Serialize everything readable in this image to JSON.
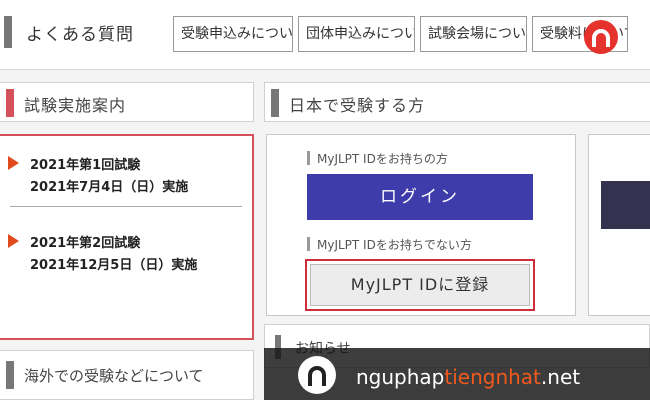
{
  "faq": {
    "title": "よくある質問",
    "buttons": [
      "受験申込みについて",
      "団体申込みについて",
      "試験会場について",
      "受験料について"
    ]
  },
  "left": {
    "header": "試験実施案内",
    "schedule": [
      {
        "title": "2021年第1回試験",
        "date": "2021年7月4日（日）実施"
      },
      {
        "title": "2021年第2回試験",
        "date": "2021年12月5日（日）実施"
      }
    ],
    "overseas_header": "海外での受験などについて"
  },
  "main": {
    "header": "日本で受験する方",
    "have_id_label": "MyJLPT IDをお持ちの方",
    "login_label": "ログイン",
    "no_id_label": "MyJLPT IDをお持ちでない方",
    "register_label": "MyJLPT IDに登録",
    "news_header": "お知らせ"
  },
  "watermark": {
    "part1": "nguphap",
    "part2": "tiengnhat",
    "part3": ".net"
  },
  "colors": {
    "accent_red": "#e04a1c",
    "login_blue": "#3d3caa",
    "highlight_red": "#cc2e3a",
    "watermark_orange": "#f25a1d"
  }
}
